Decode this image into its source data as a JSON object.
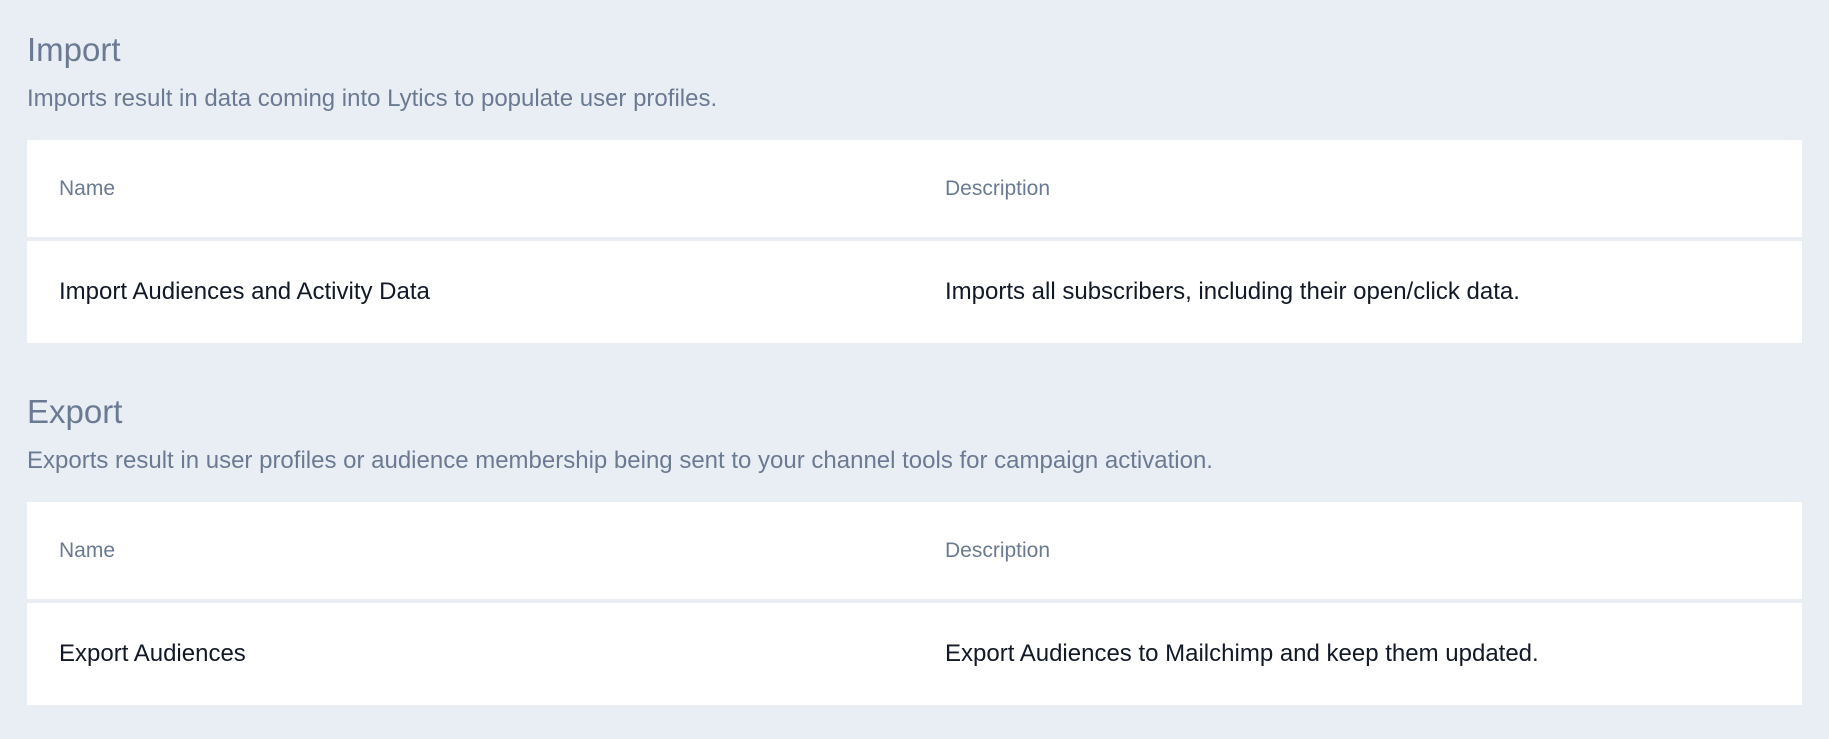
{
  "import": {
    "title": "Import",
    "description": "Imports result in data coming into Lytics to populate user profiles.",
    "columns": [
      "Name",
      "Description"
    ],
    "rows": [
      {
        "name": "Import Audiences and Activity Data",
        "description": "Imports all subscribers, including their open/click data."
      }
    ]
  },
  "export": {
    "title": "Export",
    "description": "Exports result in user profiles or audience membership being sent to your channel tools for campaign activation.",
    "columns": [
      "Name",
      "Description"
    ],
    "rows": [
      {
        "name": "Export Audiences",
        "description": "Export Audiences to Mailchimp and keep them updated."
      }
    ]
  }
}
